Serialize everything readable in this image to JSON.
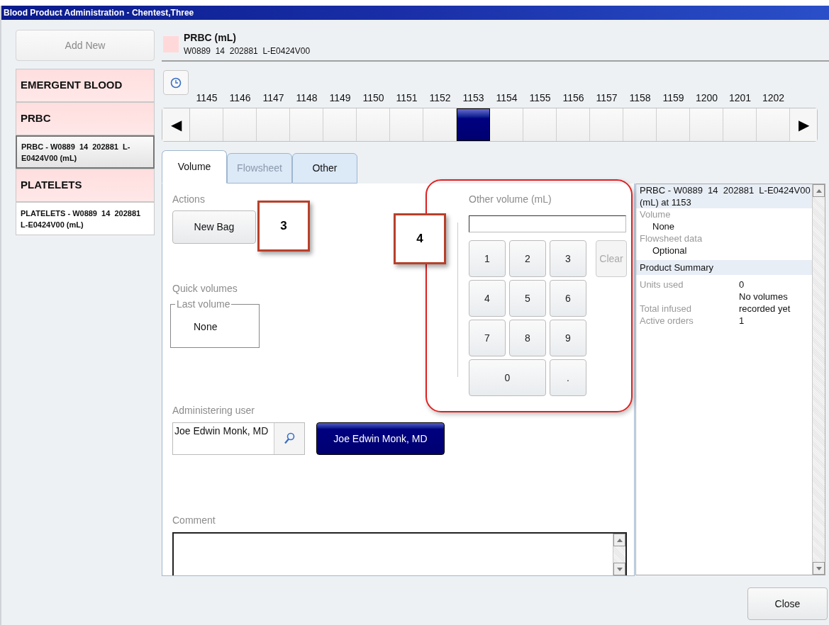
{
  "window": {
    "title": "Blood Product Administration - Chentest,Three"
  },
  "sidebar": {
    "add_button": {
      "label": "Add New",
      "disabled": true
    },
    "items": [
      {
        "kind": "category",
        "label": "EMERGENT BLOOD",
        "selected": false
      },
      {
        "kind": "category",
        "label": "PRBC",
        "selected": false
      },
      {
        "kind": "product",
        "label": "PRBC - W0889  14  202881  L-E0424V00 (mL)",
        "selected": true
      },
      {
        "kind": "category",
        "label": "PLATELETS",
        "selected": false
      },
      {
        "kind": "product",
        "label": "PLATELETS - W0889  14  202881  L-E0424V00 (mL)",
        "selected": false
      }
    ]
  },
  "product_header": {
    "color": "#ffd9d9",
    "title": "PRBC (mL)",
    "code": "W0889  14  202881  L-E0424V00"
  },
  "timeline": {
    "left_arrow": "◀",
    "right_arrow": "▶",
    "slots": [
      {
        "time": "1145",
        "selected": false
      },
      {
        "time": "1146",
        "selected": false
      },
      {
        "time": "1147",
        "selected": false
      },
      {
        "time": "1148",
        "selected": false
      },
      {
        "time": "1149",
        "selected": false
      },
      {
        "time": "1150",
        "selected": false
      },
      {
        "time": "1151",
        "selected": false
      },
      {
        "time": "1152",
        "selected": false
      },
      {
        "time": "1153",
        "selected": true
      },
      {
        "time": "1154",
        "selected": false
      },
      {
        "time": "1155",
        "selected": false
      },
      {
        "time": "1156",
        "selected": false
      },
      {
        "time": "1157",
        "selected": false
      },
      {
        "time": "1158",
        "selected": false
      },
      {
        "time": "1159",
        "selected": false
      },
      {
        "time": "1200",
        "selected": false
      },
      {
        "time": "1201",
        "selected": false
      },
      {
        "time": "1202",
        "selected": false
      }
    ]
  },
  "tabs": [
    {
      "label": "Volume",
      "selected": true,
      "disabled": false
    },
    {
      "label": "Flowsheet",
      "selected": false,
      "disabled": true
    },
    {
      "label": "Other",
      "selected": false,
      "disabled": false
    }
  ],
  "volume_tab": {
    "actions_label": "Actions",
    "new_bag_button": "New Bag",
    "quick_volumes_label": "Quick volumes",
    "last_volume": {
      "legend": "Last volume",
      "value": "None"
    },
    "other_volume": {
      "label": "Other volume (mL)",
      "keys": [
        {
          "label": "1",
          "disabled": false
        },
        {
          "label": "2",
          "disabled": false
        },
        {
          "label": "3",
          "disabled": false
        },
        {
          "label": "Clear",
          "disabled": true
        },
        {
          "label": "4",
          "disabled": false
        },
        {
          "label": "5",
          "disabled": false
        },
        {
          "label": "6",
          "disabled": false
        },
        {
          "label": "7",
          "disabled": false
        },
        {
          "label": "8",
          "disabled": false
        },
        {
          "label": "9",
          "disabled": false
        },
        {
          "label": "0",
          "disabled": false
        },
        {
          "label": ".",
          "disabled": false
        }
      ]
    },
    "administering_user": {
      "label": "Administering user",
      "value": "Joe Edwin Monk, MD",
      "selected_user_button": "Joe Edwin Monk, MD"
    },
    "comment": {
      "label": "Comment"
    }
  },
  "summary": {
    "title": "PRBC - W0889  14  202881  L-E0424V00 (mL) at 1153",
    "items": [
      {
        "label": "Volume",
        "value": "None"
      },
      {
        "label": "Flowsheet data",
        "value": "Optional"
      }
    ],
    "section": "Product Summary",
    "rows": [
      {
        "label": "Units used",
        "value": "0"
      },
      {
        "value": "No volumes"
      },
      {
        "label": "Total infused",
        "value": "recorded yet"
      },
      {
        "label": "Active orders",
        "value": "1"
      }
    ]
  },
  "close_button": "Close",
  "callouts": [
    {
      "label": "3"
    },
    {
      "label": "4"
    }
  ]
}
